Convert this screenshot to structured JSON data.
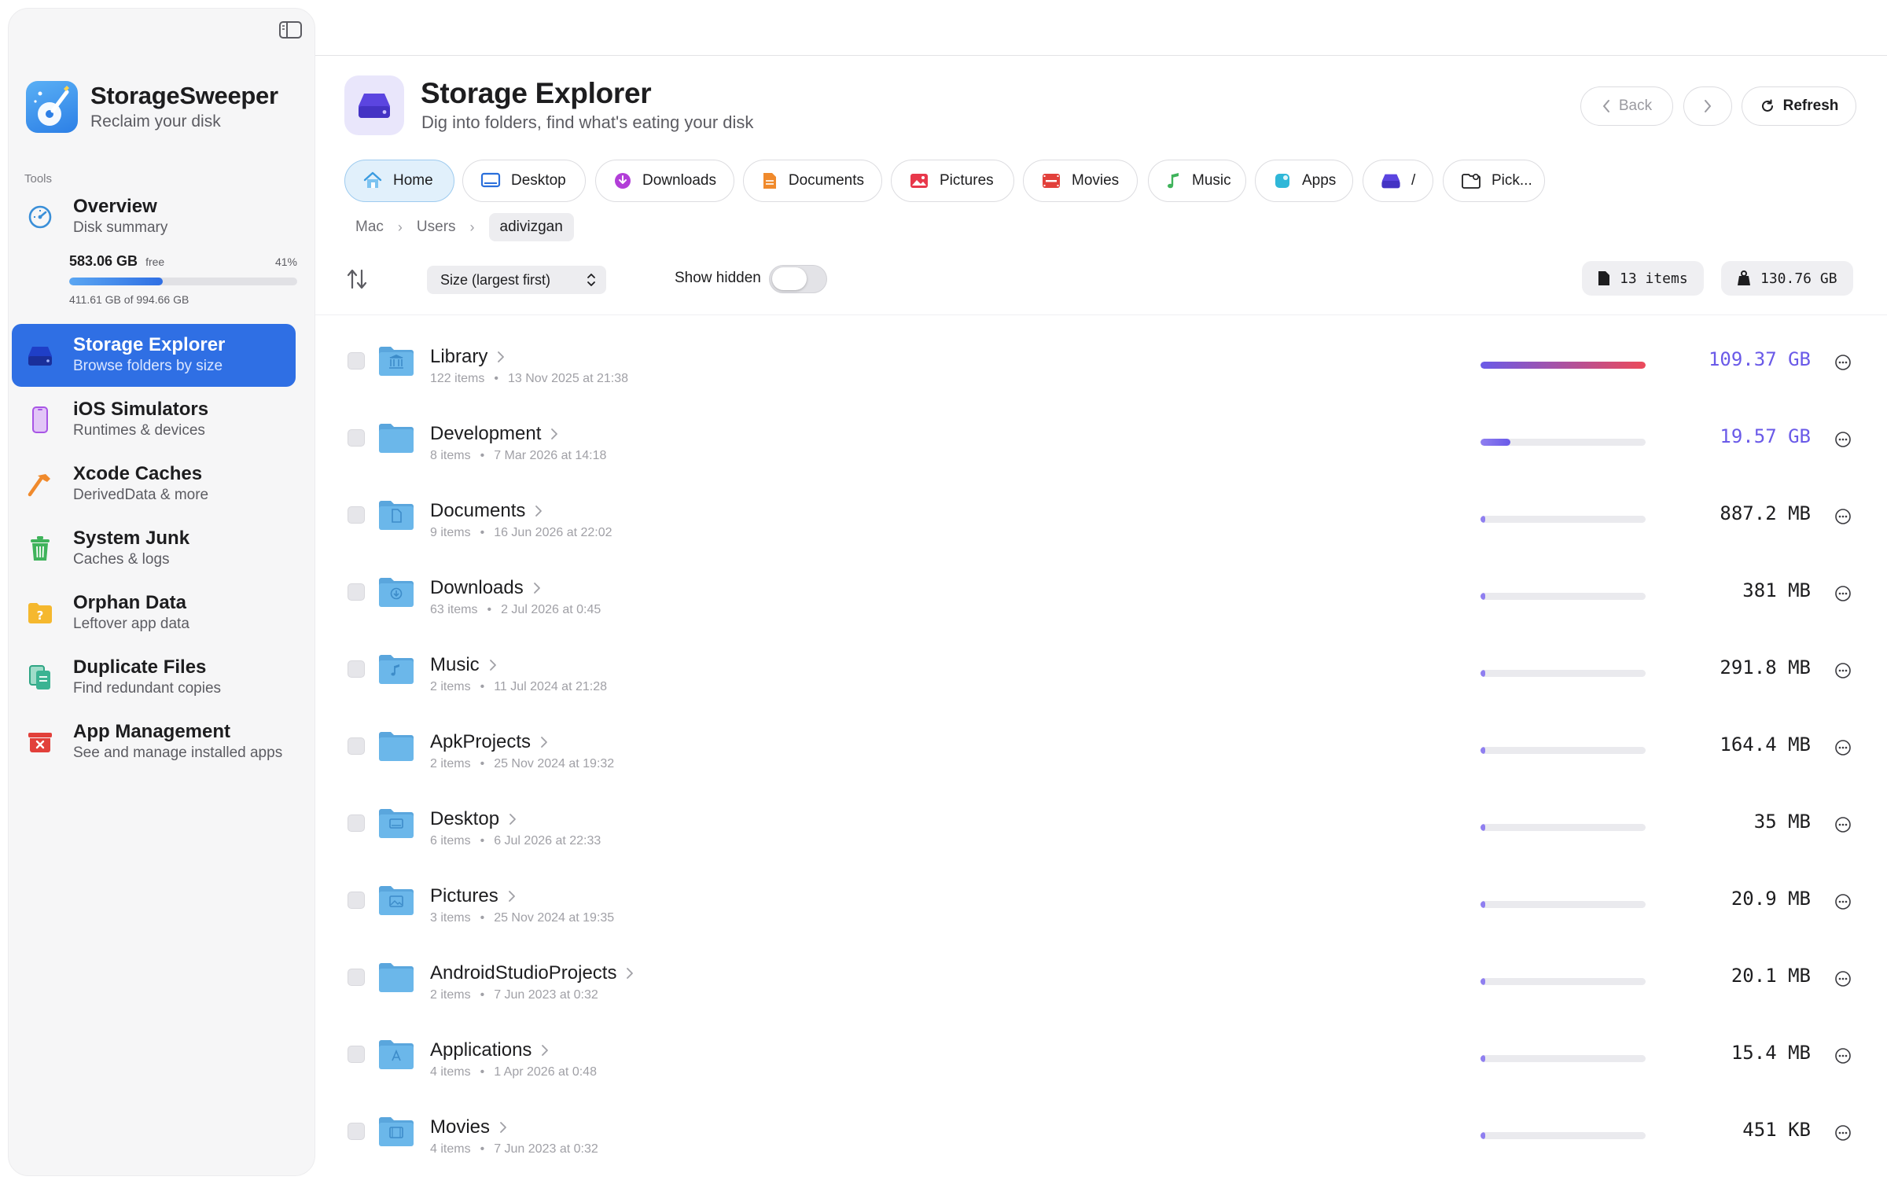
{
  "app": {
    "name": "StorageSweeper",
    "tagline": "Reclaim your disk"
  },
  "sidebar": {
    "section_label": "Tools",
    "disk": {
      "free": "583.06 GB",
      "free_label": "free",
      "percent_label": "41%",
      "used_fraction": 0.41,
      "used_label": "411.61 GB of 994.66 GB"
    },
    "items": [
      {
        "title": "Overview",
        "subtitle": "Disk summary",
        "icon": "gauge-icon"
      },
      {
        "title": "Storage Explorer",
        "subtitle": "Browse folders by size",
        "icon": "drive-icon"
      },
      {
        "title": "iOS Simulators",
        "subtitle": "Runtimes & devices",
        "icon": "iphone-icon"
      },
      {
        "title": "Xcode Caches",
        "subtitle": "DerivedData & more",
        "icon": "hammer-icon"
      },
      {
        "title": "System Junk",
        "subtitle": "Caches & logs",
        "icon": "trash-icon"
      },
      {
        "title": "Orphan Data",
        "subtitle": "Leftover app data",
        "icon": "question-folder-icon"
      },
      {
        "title": "Duplicate Files",
        "subtitle": "Find redundant copies",
        "icon": "duplicate-docs-icon"
      },
      {
        "title": "App Management",
        "subtitle": "See and manage installed apps",
        "icon": "app-remove-icon"
      }
    ]
  },
  "header": {
    "title": "Storage Explorer",
    "subtitle": "Dig into folders, find what's eating your disk",
    "back_label": "Back",
    "refresh_label": "Refresh"
  },
  "locations": [
    {
      "label": "Home",
      "icon": "home-icon"
    },
    {
      "label": "Desktop",
      "icon": "desktop-icon"
    },
    {
      "label": "Downloads",
      "icon": "download-icon"
    },
    {
      "label": "Documents",
      "icon": "document-icon"
    },
    {
      "label": "Pictures",
      "icon": "photo-icon"
    },
    {
      "label": "Movies",
      "icon": "film-icon"
    },
    {
      "label": "Music",
      "icon": "music-note-icon"
    },
    {
      "label": "Apps",
      "icon": "apps-icon"
    },
    {
      "label": "/",
      "icon": "drive-icon"
    },
    {
      "label": "Pick...",
      "icon": "folder-picker-icon"
    }
  ],
  "breadcrumb": [
    "Mac",
    "Users",
    "adivizgan"
  ],
  "toolbar": {
    "sort_value": "Size (largest first)",
    "show_hidden_label": "Show hidden",
    "show_hidden_on": false,
    "items_count": "13 items",
    "total_size": "130.76 GB"
  },
  "folders": [
    {
      "name": "Library",
      "items": "122 items",
      "date": "13 Nov 2025 at 21:38",
      "size": "109.37 GB",
      "fraction": 1.0,
      "glyph": "library"
    },
    {
      "name": "Development",
      "items": "8 items",
      "date": "7 Mar 2026 at 14:18",
      "size": "19.57 GB",
      "fraction": 0.179,
      "glyph": "none"
    },
    {
      "name": "Documents",
      "items": "9 items",
      "date": "16 Jun 2026 at 22:02",
      "size": "887.2 MB",
      "fraction": 0.008,
      "glyph": "doc"
    },
    {
      "name": "Downloads",
      "items": "63 items",
      "date": "2 Jul 2026 at 0:45",
      "size": "381 MB",
      "fraction": 0.0035,
      "glyph": "download"
    },
    {
      "name": "Music",
      "items": "2 items",
      "date": "11 Jul 2024 at 21:28",
      "size": "291.8 MB",
      "fraction": 0.0027,
      "glyph": "music"
    },
    {
      "name": "ApkProjects",
      "items": "2 items",
      "date": "25 Nov 2024 at 19:32",
      "size": "164.4 MB",
      "fraction": 0.0015,
      "glyph": "none"
    },
    {
      "name": "Desktop",
      "items": "6 items",
      "date": "6 Jul 2026 at 22:33",
      "size": "35 MB",
      "fraction": 0.0003,
      "glyph": "desktop"
    },
    {
      "name": "Pictures",
      "items": "3 items",
      "date": "25 Nov 2024 at 19:35",
      "size": "20.9 MB",
      "fraction": 0.0002,
      "glyph": "photo"
    },
    {
      "name": "AndroidStudioProjects",
      "items": "2 items",
      "date": "7 Jun 2023 at 0:32",
      "size": "20.1 MB",
      "fraction": 0.0002,
      "glyph": "none"
    },
    {
      "name": "Applications",
      "items": "4 items",
      "date": "1 Apr 2026 at 0:48",
      "size": "15.4 MB",
      "fraction": 0.0001,
      "glyph": "apps"
    },
    {
      "name": "Movies",
      "items": "4 items",
      "date": "7 Jun 2023 at 0:32",
      "size": "451 KB",
      "fraction": 0.0,
      "glyph": "film"
    }
  ],
  "colors": {
    "accent": "#2f6fe4",
    "big_size": "#6a5ae8",
    "bar_gradient_start": "#6a5ae8",
    "bar_gradient_end": "#ec4a5a",
    "folder": "#6bb7ea"
  }
}
